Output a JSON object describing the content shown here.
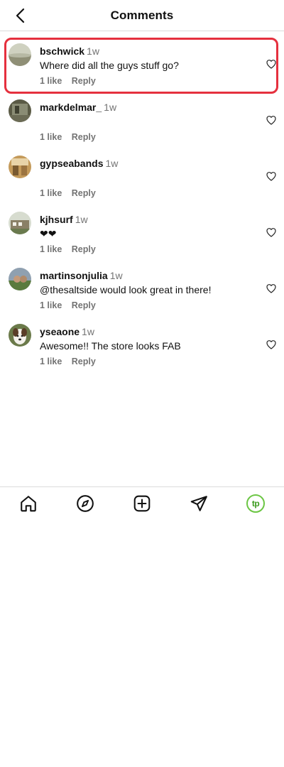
{
  "header": {
    "title": "Comments"
  },
  "comments": [
    {
      "username": "bschwick",
      "time": "1w",
      "text": "Where did all the guys stuff go?",
      "likes": "1 like",
      "reply": "Reply",
      "selected": true
    },
    {
      "username": "markdelmar_",
      "time": "1w",
      "text": "",
      "likes": "1 like",
      "reply": "Reply"
    },
    {
      "username": "gypseabands",
      "time": "1w",
      "text": "",
      "likes": "1 like",
      "reply": "Reply"
    },
    {
      "username": "kjhsurf",
      "time": "1w",
      "text": "❤❤",
      "likes": "1 like",
      "reply": "Reply"
    },
    {
      "username": "martinsonjulia",
      "time": "1w",
      "text": "@thesaltside would look great in there!",
      "likes": "1 like",
      "reply": "Reply"
    },
    {
      "username": "yseaone",
      "time": "1w",
      "text": "Awesome!! The store looks FAB",
      "likes": "1 like",
      "reply": "Reply"
    }
  ],
  "nav": {
    "profile_badge": "tp"
  },
  "colors": {
    "selection_border": "#e5303e",
    "secondary_text": "#737373",
    "profile_ring": "#6cc644"
  }
}
